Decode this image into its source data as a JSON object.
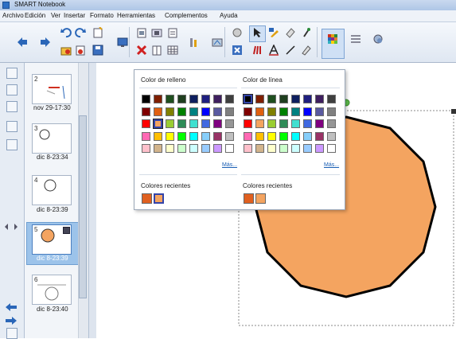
{
  "window": {
    "title": "SMART Notebook"
  },
  "menu": [
    "Archivo",
    "Edición",
    "Ver",
    "Insertar",
    "Formato",
    "Herramientas",
    "Complementos",
    "Ayuda"
  ],
  "toolbar": {
    "icons": [
      "back-arrow-icon",
      "forward-arrow-icon",
      "undo-icon",
      "redo-icon",
      "new-page-icon",
      "open-icon",
      "delete-page-icon",
      "save-icon",
      "screen-shade-icon",
      "paste-icon",
      "delete-icon",
      "cut-icon",
      "table-icon",
      "capture-icon",
      "document-camera-icon",
      "zoom-icon",
      "select-pointer-icon",
      "fill-icon",
      "eraser-icon",
      "magic-pen-icon",
      "pens-icon",
      "text-icon",
      "line-icon",
      "shapes-icon",
      "color-palette-icon",
      "line-style-icon",
      "transparency-icon"
    ]
  },
  "sidebar": {
    "pages": [
      {
        "number": "2",
        "label": "nov 29-17:30"
      },
      {
        "number": "3",
        "label": "dic 8-23:34"
      },
      {
        "number": "4",
        "label": "dic 8-23:39"
      },
      {
        "number": "5",
        "label": "dic 8-23:39",
        "selected": true
      },
      {
        "number": "6",
        "label": "dic 8-23:40"
      }
    ]
  },
  "popup": {
    "fill_title": "Color de relleno",
    "line_title": "Color de línea",
    "more_label": "Más...",
    "recent_title": "Colores recientes",
    "fill_selected": "#f4a460",
    "line_selected": "#000000",
    "palette": [
      [
        "#000000",
        "#7f1f00",
        "#1f4f1f",
        "#1f3f1f",
        "#0f1f5f",
        "#1f1f7f",
        "#3f1f5f",
        "#3f3f3f"
      ],
      [
        "#7f0000",
        "#e06010",
        "#808000",
        "#008000",
        "#008080",
        "#0000ff",
        "#5a5aa0",
        "#808080"
      ],
      [
        "#ff0000",
        "#f4a460",
        "#9acd32",
        "#2e8b57",
        "#40e0d0",
        "#4169e1",
        "#800080",
        "#969696"
      ],
      [
        "#ff69b4",
        "#ffbf00",
        "#ffff00",
        "#00ff00",
        "#00ffff",
        "#87cefa",
        "#993366",
        "#c0c0c0"
      ],
      [
        "#ffc0cb",
        "#d2b48c",
        "#ffffcc",
        "#ccffcc",
        "#ccffff",
        "#99ccff",
        "#cc99ff",
        "#ffffff"
      ]
    ],
    "recent_fill": [
      "#e06020",
      "#f4a460"
    ],
    "recent_line": [
      "#e06020",
      "#f4a460"
    ]
  },
  "canvas": {
    "shape_fill": "#f4a460",
    "shape_stroke": "#000000"
  }
}
